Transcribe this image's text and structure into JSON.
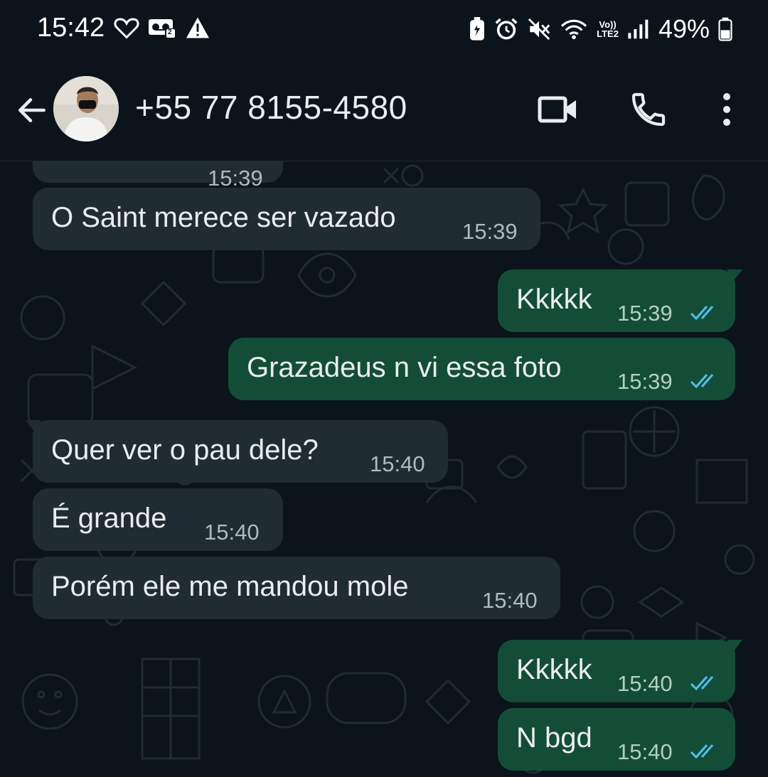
{
  "status_bar": {
    "time": "15:42",
    "battery_percent": "49%",
    "network_label_top": "Vo))",
    "network_label_bottom": "LTE2",
    "voicemail_count": "2",
    "icons": [
      "heart-icon",
      "voicemail-icon",
      "warning-icon",
      "battery-saver-icon",
      "alarm-icon",
      "mute-icon",
      "wifi-icon",
      "signal-icon",
      "battery-icon"
    ]
  },
  "header": {
    "contact_name": "+55 77 8155-4580",
    "icons": [
      "back-arrow-icon",
      "video-call-icon",
      "phone-call-icon",
      "more-options-icon"
    ]
  },
  "messages": [
    {
      "direction": "incoming",
      "text": "",
      "time": "15:39",
      "partial": true
    },
    {
      "direction": "incoming",
      "text": "O Saint merece ser vazado",
      "time": "15:39"
    },
    {
      "direction": "outgoing",
      "text": "Kkkkk",
      "time": "15:39",
      "status": "read"
    },
    {
      "direction": "outgoing",
      "text": "Grazadeus n vi essa foto",
      "time": "15:39",
      "status": "read"
    },
    {
      "direction": "incoming",
      "text": "Quer ver o pau dele?",
      "time": "15:40"
    },
    {
      "direction": "incoming",
      "text": "É grande",
      "time": "15:40"
    },
    {
      "direction": "incoming",
      "text": "Porém ele me mandou mole",
      "time": "15:40"
    },
    {
      "direction": "outgoing",
      "text": "Kkkkk",
      "time": "15:40",
      "status": "read"
    },
    {
      "direction": "outgoing",
      "text": "N bgd",
      "time": "15:40",
      "status": "read"
    }
  ],
  "colors": {
    "background": "#0b141a",
    "incoming_bubble": "#202c33",
    "outgoing_bubble": "#144d37",
    "read_ticks": "#53bdeb"
  }
}
